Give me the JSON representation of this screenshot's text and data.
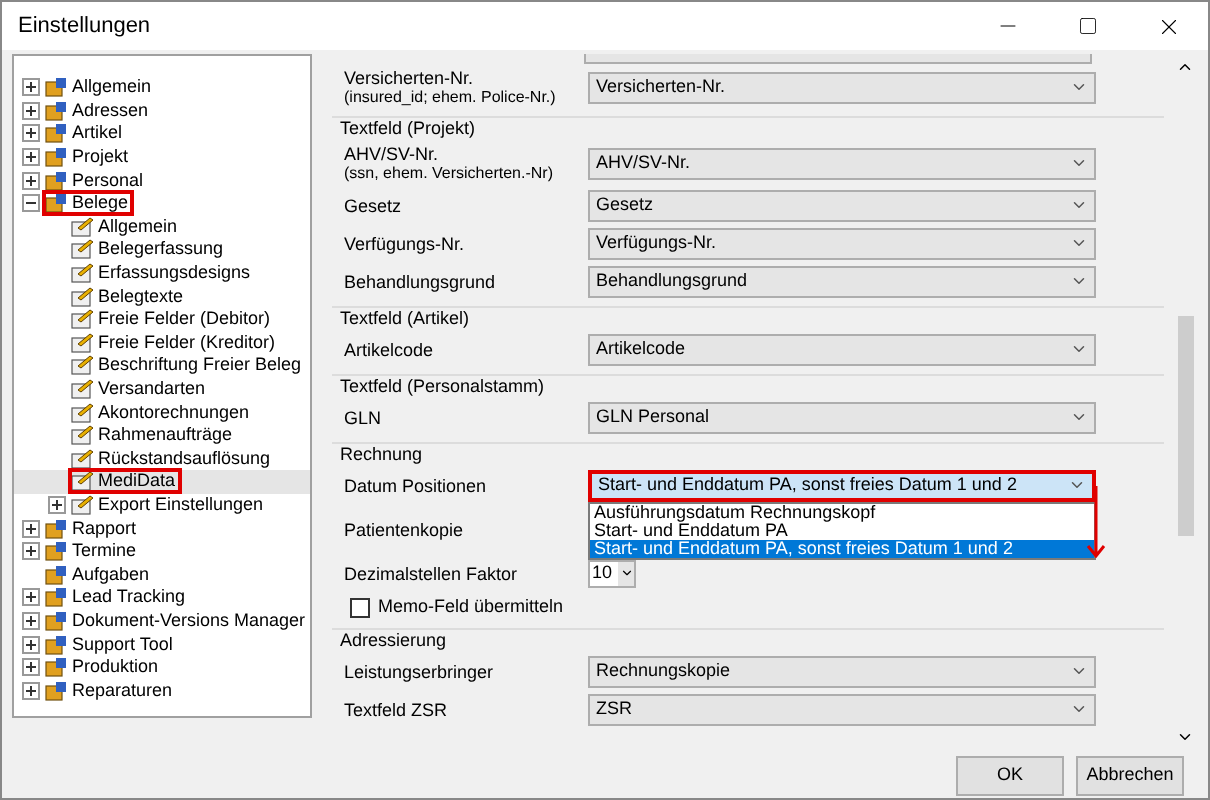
{
  "window": {
    "title": "Einstellungen"
  },
  "tree": [
    {
      "label": "Allgemein",
      "expanded": false,
      "selected": false,
      "highlighted": false
    },
    {
      "label": "Adressen",
      "expanded": false,
      "selected": false,
      "highlighted": false
    },
    {
      "label": "Artikel",
      "expanded": false,
      "selected": false,
      "highlighted": false
    },
    {
      "label": "Projekt",
      "expanded": false,
      "selected": false,
      "highlighted": false
    },
    {
      "label": "Personal",
      "expanded": false,
      "selected": false,
      "highlighted": false
    },
    {
      "label": "Belege",
      "expanded": true,
      "selected": false,
      "highlighted": true,
      "children": [
        {
          "label": "Allgemein",
          "selected": false,
          "highlighted": false
        },
        {
          "label": "Belegerfassung",
          "selected": false,
          "highlighted": false
        },
        {
          "label": "Erfassungsdesigns",
          "selected": false,
          "highlighted": false
        },
        {
          "label": "Belegtexte",
          "selected": false,
          "highlighted": false
        },
        {
          "label": "Freie Felder (Debitor)",
          "selected": false,
          "highlighted": false
        },
        {
          "label": "Freie Felder (Kreditor)",
          "selected": false,
          "highlighted": false
        },
        {
          "label": "Beschriftung Freier Beleg",
          "selected": false,
          "highlighted": false
        },
        {
          "label": "Versandarten",
          "selected": false,
          "highlighted": false
        },
        {
          "label": "Akontorechnungen",
          "selected": false,
          "highlighted": false
        },
        {
          "label": "Rahmenaufträge",
          "selected": false,
          "highlighted": false
        },
        {
          "label": "Rückstandsauflösung",
          "selected": false,
          "highlighted": false
        },
        {
          "label": "MediData",
          "selected": true,
          "highlighted": true
        },
        {
          "label": "Export Einstellungen",
          "expanded": false,
          "selected": false,
          "highlighted": false
        }
      ]
    },
    {
      "label": "Rapport",
      "expanded": false,
      "selected": false,
      "highlighted": false
    },
    {
      "label": "Termine",
      "expanded": false,
      "selected": false,
      "highlighted": false
    },
    {
      "label": "Aufgaben",
      "selected": false,
      "highlighted": false
    },
    {
      "label": "Lead Tracking",
      "expanded": false,
      "selected": false,
      "highlighted": false
    },
    {
      "label": "Dokument-Versions Manager",
      "expanded": false,
      "selected": false,
      "highlighted": false
    },
    {
      "label": "Support Tool",
      "expanded": false,
      "selected": false,
      "highlighted": false
    },
    {
      "label": "Produktion",
      "expanded": false,
      "selected": false,
      "highlighted": false
    },
    {
      "label": "Reparaturen",
      "expanded": false,
      "selected": false,
      "highlighted": false
    }
  ],
  "sections": [
    {
      "rows": [
        {
          "kind": "combo",
          "label": "Versicherten-Nr.",
          "sublabel": "(insured_id; ehem. Police-Nr.)",
          "value": "Versicherten-Nr.",
          "highlighted": false
        }
      ]
    },
    {
      "title": "Textfeld (Projekt)",
      "rows": [
        {
          "kind": "combo",
          "label": "AHV/SV-Nr.",
          "sublabel": "(ssn, ehem. Versicherten.-Nr)",
          "value": "AHV/SV-Nr.",
          "highlighted": false
        },
        {
          "kind": "combo",
          "label": "Gesetz",
          "value": "Gesetz",
          "highlighted": false
        },
        {
          "kind": "combo",
          "label": "Verfügungs-Nr.",
          "value": "Verfügungs-Nr.",
          "highlighted": false
        },
        {
          "kind": "combo",
          "label": "Behandlungsgrund",
          "value": "Behandlungsgrund",
          "highlighted": false
        }
      ]
    },
    {
      "title": "Textfeld (Artikel)",
      "rows": [
        {
          "kind": "combo",
          "label": "Artikelcode",
          "value": "Artikelcode",
          "highlighted": false
        }
      ]
    },
    {
      "title": "Textfeld (Personalstamm)",
      "rows": [
        {
          "kind": "combo",
          "label": "GLN",
          "value": "GLN Personal",
          "highlighted": false
        }
      ]
    },
    {
      "title": "Rechnung",
      "rows": [
        {
          "kind": "combo",
          "label": "Datum Positionen",
          "value": "Start- und Enddatum PA, sonst freies Datum 1 und 2",
          "highlighted": true,
          "options": [
            {
              "label": "Ausführungsdatum Rechnungskopf",
              "selected": false
            },
            {
              "label": "Start- und Enddatum PA",
              "selected": false
            },
            {
              "label": "Start- und Enddatum PA, sonst freies Datum 1 und 2",
              "selected": true
            }
          ]
        },
        {
          "kind": "label",
          "label": "Patientenkopie"
        },
        {
          "kind": "spin",
          "label": "Dezimalstellen Faktor",
          "value": "10"
        },
        {
          "kind": "checkbox",
          "label": "Memo-Feld übermitteln",
          "checked": false
        }
      ]
    },
    {
      "title": "Adressierung",
      "rows": [
        {
          "kind": "combo",
          "label": "Leistungserbringer",
          "value": "Rechnungskopie",
          "highlighted": false
        },
        {
          "kind": "combo",
          "label": "Textfeld ZSR",
          "value": "ZSR",
          "highlighted": false
        }
      ]
    }
  ],
  "buttons": [
    {
      "label": "OK"
    },
    {
      "label": "Abbrechen"
    }
  ]
}
